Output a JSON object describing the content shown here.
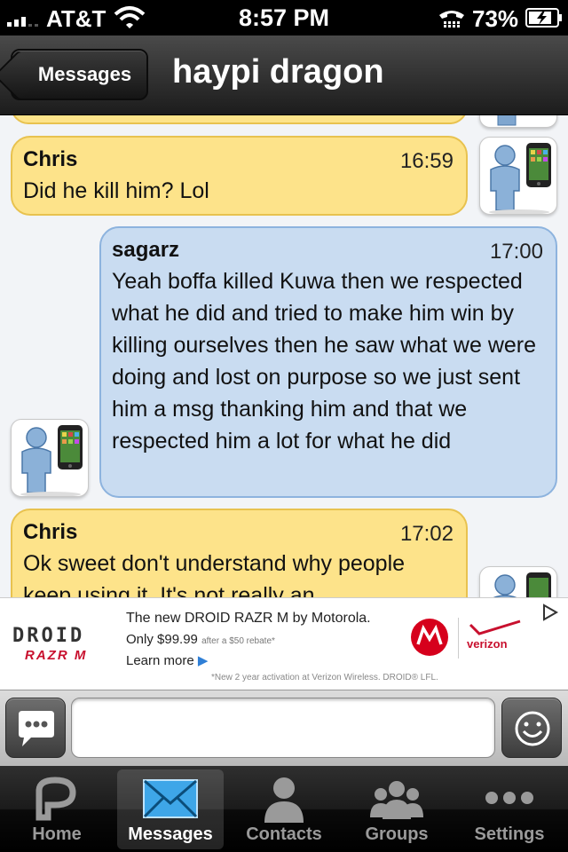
{
  "status_bar": {
    "carrier": "AT&T",
    "time": "8:57 PM",
    "battery_percent": "73%",
    "signal_bars": 3
  },
  "nav": {
    "back_label": "Messages",
    "title": "haypi dragon"
  },
  "messages": [
    {
      "sender": "Chris",
      "time": "16:59",
      "text": "Did he kill him? Lol"
    },
    {
      "sender": "sagarz",
      "time": "17:00",
      "text": "Yeah boffa killed Kuwa then we respected what he did and tried to make him win by killing ourselves then he saw what we were doing and lost on purpose so we just sent him a msg thanking him and that we respected him a lot for what he did"
    },
    {
      "sender": "Chris",
      "time": "17:02",
      "text": "Ok sweet don't understand why people keep using it. It's not really an"
    }
  ],
  "ad": {
    "brand_logo": "DROID",
    "brand_sub": "RAZR M",
    "headline": "The new DROID RAZR M by Motorola.",
    "price": "Only $99.99",
    "rebate": "after a $50 rebate*",
    "learn_more": "Learn more",
    "fine_print": "*New 2 year activation at Verizon Wireless. DROID® LFL.",
    "carrier": "verizon"
  },
  "input": {
    "value": "",
    "placeholder": ""
  },
  "tabs": [
    {
      "label": "Home",
      "icon": "pinger-home-icon"
    },
    {
      "label": "Messages",
      "icon": "envelope-icon"
    },
    {
      "label": "Contacts",
      "icon": "person-icon"
    },
    {
      "label": "Groups",
      "icon": "group-icon"
    },
    {
      "label": "Settings",
      "icon": "more-dots-icon"
    }
  ],
  "colors": {
    "incoming_bubble": "#fde38a",
    "outgoing_bubble": "#c9dcf1",
    "accent_blue": "#3ea6e8"
  }
}
